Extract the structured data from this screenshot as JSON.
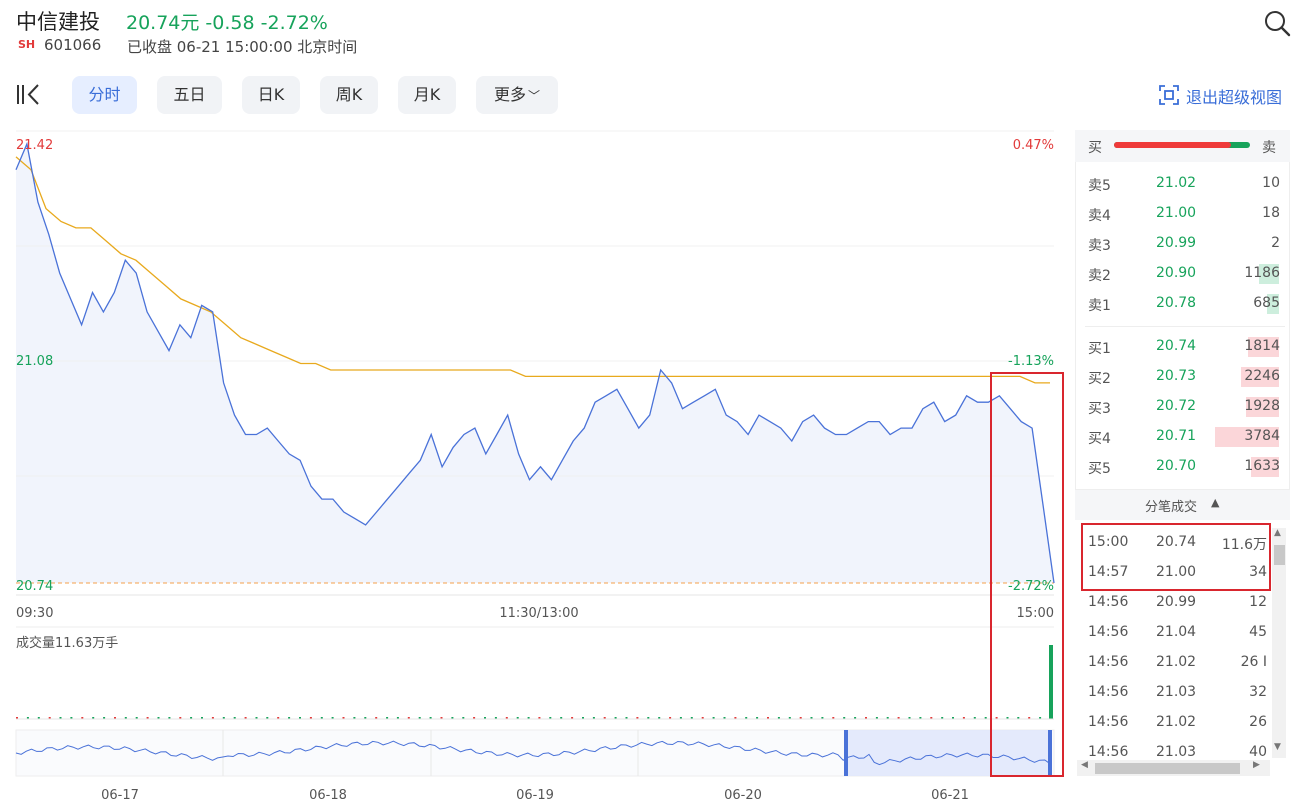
{
  "header": {
    "name": "中信建投",
    "price_line": "20.74元 -0.58 -2.72%",
    "exchange": "SH",
    "code": "601066",
    "status": "已收盘 06-21 15:00:00 北京时间"
  },
  "toolbar": {
    "tabs": [
      "分时",
      "五日",
      "日K",
      "周K",
      "月K",
      "更多"
    ],
    "active_tab": "分时",
    "exit_label": "退出超级视图"
  },
  "chart": {
    "price_labels": [
      "21.42",
      "21.08",
      "20.74"
    ],
    "pct_labels": [
      "0.47%",
      "-1.13%",
      "-2.72%"
    ],
    "time_labels": [
      "09:30",
      "11:30/13:00",
      "15:00"
    ],
    "volume_label": "成交量11.63万手",
    "nav_dates": [
      "06-17",
      "06-18",
      "06-19",
      "06-20",
      "06-21"
    ],
    "colors": {
      "up": "#e23b3b",
      "down": "#17a35b",
      "price_line": "#4a72d8",
      "avg_line": "#e8a91d"
    }
  },
  "chart_data": {
    "type": "line",
    "ylim": [
      20.74,
      21.42
    ],
    "series": [
      {
        "name": "price",
        "values": [
          21.38,
          21.42,
          21.33,
          21.28,
          21.22,
          21.18,
          21.14,
          21.19,
          21.16,
          21.19,
          21.24,
          21.22,
          21.16,
          21.13,
          21.1,
          21.14,
          21.12,
          21.17,
          21.16,
          21.05,
          21.0,
          20.97,
          20.97,
          20.98,
          20.96,
          20.94,
          20.93,
          20.89,
          20.87,
          20.87,
          20.85,
          20.84,
          20.83,
          20.85,
          20.87,
          20.89,
          20.91,
          20.93,
          20.97,
          20.92,
          20.95,
          20.97,
          20.98,
          20.94,
          20.97,
          21.0,
          20.94,
          20.9,
          20.92,
          20.9,
          20.93,
          20.96,
          20.98,
          21.02,
          21.03,
          21.04,
          21.01,
          20.98,
          21.0,
          21.07,
          21.05,
          21.01,
          21.02,
          21.03,
          21.04,
          21.0,
          20.99,
          20.97,
          21.0,
          20.99,
          20.98,
          20.96,
          20.99,
          21.0,
          20.98,
          20.97,
          20.97,
          20.98,
          20.99,
          20.99,
          20.97,
          20.98,
          20.98,
          21.01,
          21.02,
          20.99,
          21.0,
          21.03,
          21.02,
          21.02,
          21.03,
          21.01,
          20.99,
          20.98,
          20.86,
          20.74
        ]
      },
      {
        "name": "avg",
        "values": [
          21.4,
          21.38,
          21.32,
          21.3,
          21.29,
          21.29,
          21.27,
          21.25,
          21.24,
          21.22,
          21.2,
          21.18,
          21.17,
          21.16,
          21.14,
          21.12,
          21.11,
          21.1,
          21.09,
          21.08,
          21.08,
          21.07,
          21.07,
          21.07,
          21.07,
          21.07,
          21.07,
          21.07,
          21.07,
          21.07,
          21.07,
          21.07,
          21.07,
          21.07,
          21.06,
          21.06,
          21.06,
          21.06,
          21.06,
          21.06,
          21.06,
          21.06,
          21.06,
          21.06,
          21.06,
          21.06,
          21.06,
          21.06,
          21.06,
          21.06,
          21.06,
          21.06,
          21.06,
          21.06,
          21.06,
          21.06,
          21.06,
          21.06,
          21.06,
          21.06,
          21.06,
          21.06,
          21.06,
          21.06,
          21.06,
          21.06,
          21.06,
          21.06,
          21.05,
          21.05
        ]
      }
    ]
  },
  "orderbook": {
    "header_buy": "买",
    "header_sell": "卖",
    "asks": [
      {
        "label": "卖5",
        "price": "21.02",
        "vol": "10",
        "bar": 0
      },
      {
        "label": "卖4",
        "price": "21.00",
        "vol": "18",
        "bar": 0
      },
      {
        "label": "卖3",
        "price": "20.99",
        "vol": "2",
        "bar": 0
      },
      {
        "label": "卖2",
        "price": "20.90",
        "vol": "1186",
        "bar": 0.31
      },
      {
        "label": "卖1",
        "price": "20.78",
        "vol": "685",
        "bar": 0.18
      }
    ],
    "bids": [
      {
        "label": "买1",
        "price": "20.74",
        "vol": "1814",
        "bar": 0.48
      },
      {
        "label": "买2",
        "price": "20.73",
        "vol": "2246",
        "bar": 0.59
      },
      {
        "label": "买3",
        "price": "20.72",
        "vol": "1928",
        "bar": 0.51
      },
      {
        "label": "买4",
        "price": "20.71",
        "vol": "3784",
        "bar": 1.0
      },
      {
        "label": "买5",
        "price": "20.70",
        "vol": "1633",
        "bar": 0.43
      }
    ],
    "buy_ratio": 0.86
  },
  "ticks": {
    "title": "分笔成交",
    "rows": [
      {
        "time": "15:00",
        "price": "20.74",
        "vol": "11.6万"
      },
      {
        "time": "14:57",
        "price": "21.00",
        "vol": "34"
      },
      {
        "time": "14:56",
        "price": "20.99",
        "vol": "12"
      },
      {
        "time": "14:56",
        "price": "21.04",
        "vol": "45"
      },
      {
        "time": "14:56",
        "price": "21.02",
        "vol": "26 I"
      },
      {
        "time": "14:56",
        "price": "21.03",
        "vol": "32"
      },
      {
        "time": "14:56",
        "price": "21.02",
        "vol": "26"
      },
      {
        "time": "14:56",
        "price": "21.03",
        "vol": "40"
      }
    ]
  }
}
